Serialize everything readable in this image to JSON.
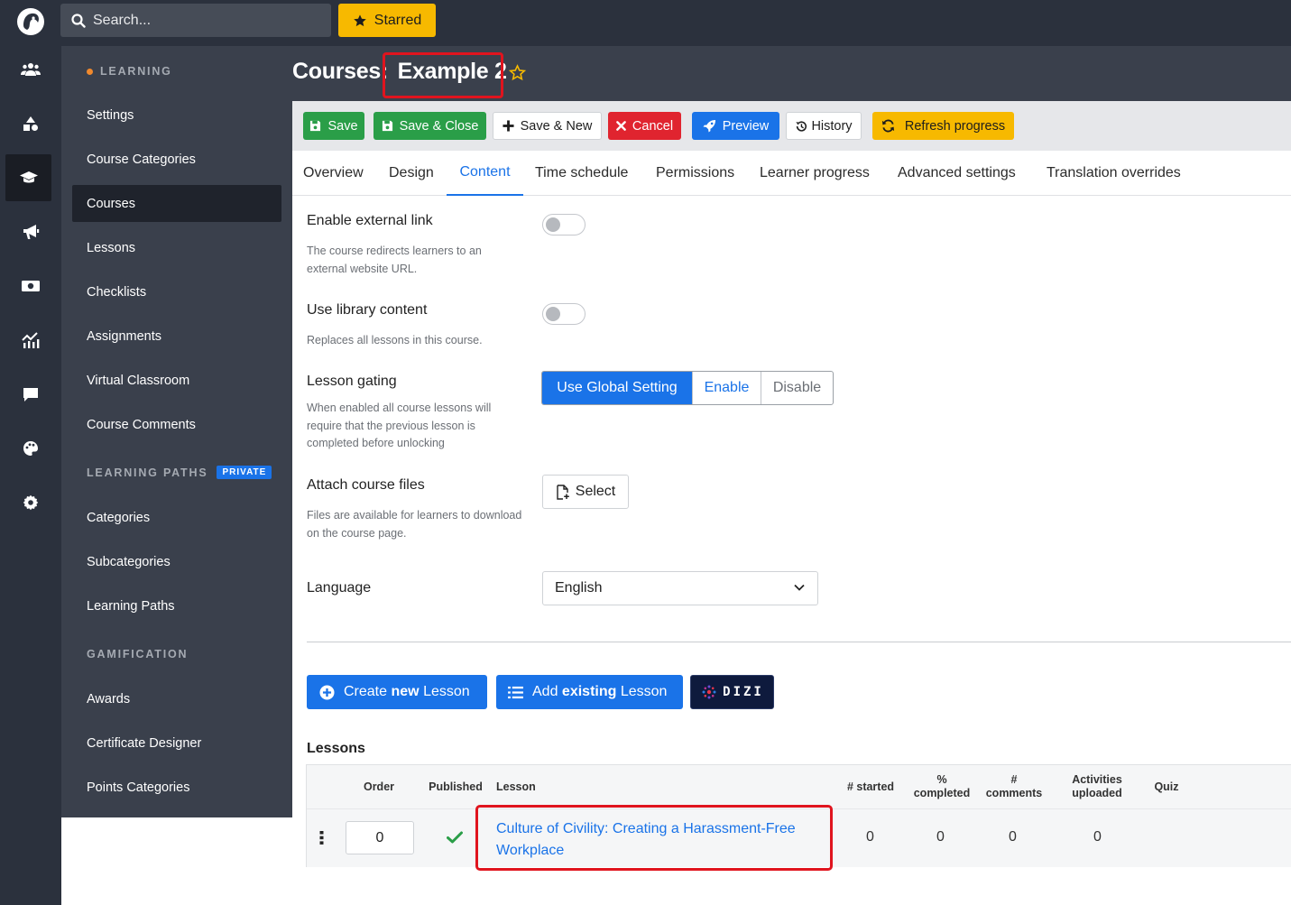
{
  "topbar": {
    "search_placeholder": "Search...",
    "starred_label": "Starred"
  },
  "rail": {
    "icons": [
      "users-icon",
      "shapes-icon",
      "graduation-cap-icon",
      "megaphone-icon",
      "money-icon",
      "analytics-icon",
      "chat-icon",
      "palette-icon",
      "gear-icon"
    ],
    "active": "graduation-cap-icon"
  },
  "sidebar": {
    "learning_header": "LEARNING",
    "learning_items": [
      "Settings",
      "Course Categories",
      "Courses",
      "Lessons",
      "Checklists",
      "Assignments",
      "Virtual Classroom",
      "Course Comments"
    ],
    "active_item": "Courses",
    "paths_header": "LEARNING PATHS",
    "paths_badge": "PRIVATE",
    "paths_items": [
      "Categories",
      "Subcategories",
      "Learning Paths"
    ],
    "gamification_header": "GAMIFICATION",
    "gamification_items": [
      "Awards",
      "Certificate Designer",
      "Points Categories"
    ]
  },
  "header": {
    "title_prefix": "Courses:",
    "title_name": "Example 2"
  },
  "toolbar": {
    "save": "Save",
    "save_close": "Save & Close",
    "save_new": "Save & New",
    "cancel": "Cancel",
    "preview": "Preview",
    "history": "History",
    "refresh": "Refresh progress"
  },
  "tabs": [
    "Overview",
    "Design",
    "Content",
    "Time schedule",
    "Permissions",
    "Learner progress",
    "Advanced settings",
    "Translation overrides"
  ],
  "active_tab": "Content",
  "form": {
    "external_link_label": "Enable external link",
    "external_link_help": "The course redirects learners to an external website URL.",
    "external_link_on": false,
    "library_label": "Use library content",
    "library_help": "Replaces all lessons in this course.",
    "library_on": false,
    "gating_label": "Lesson gating",
    "gating_help": "When enabled all course lessons will require that the previous lesson is completed before unlocking",
    "gating_options": [
      "Use Global Setting",
      "Enable",
      "Disable"
    ],
    "gating_selected": "Use Global Setting",
    "files_label": "Attach course files",
    "files_help": "Files are available for learners to download on the course page.",
    "files_button": "Select",
    "language_label": "Language",
    "language_value": "English"
  },
  "actions": {
    "create_pre": "Create",
    "create_bold": "new",
    "create_post": "Lesson",
    "add_pre": "Add",
    "add_bold": "existing",
    "add_post": "Lesson",
    "dizi_label": "DIZI"
  },
  "lessons": {
    "title": "Lessons",
    "headers": {
      "order": "Order",
      "published": "Published",
      "lesson": "Lesson",
      "started": "# started",
      "completed_1": "%",
      "completed_2": "completed",
      "comments_1": "#",
      "comments_2": "comments",
      "activities_1": "Activities",
      "activities_2": "uploaded",
      "quiz": "Quiz"
    },
    "rows": [
      {
        "order": "0",
        "published": true,
        "lesson": "Culture of Civility: Creating a Harassment-Free Workplace",
        "started": "0",
        "completed": "0",
        "comments": "0",
        "activities": "0",
        "quiz": ""
      }
    ]
  },
  "colors": {
    "accent": "#1a73e8",
    "success": "#2a9e48",
    "danger": "#e0242f",
    "warning": "#f7b900",
    "dark": "#2b313d",
    "sidebar": "#3a404c"
  }
}
